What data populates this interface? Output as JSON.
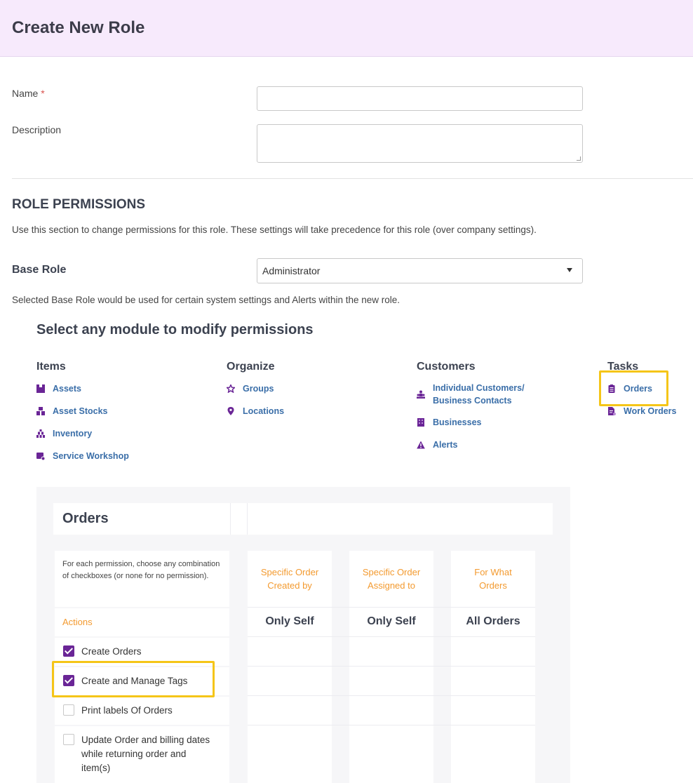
{
  "header": {
    "title": "Create New Role"
  },
  "form": {
    "name_label": "Name",
    "required_mark": "*",
    "name_value": "",
    "description_label": "Description",
    "description_value": ""
  },
  "permissions": {
    "title": "ROLE PERMISSIONS",
    "description": "Use this section to change permissions for this role. These settings will take precedence for this role (over company settings).",
    "base_role_label": "Base Role",
    "base_role_value": "Administrator",
    "base_role_note": "Selected Base Role would be used for certain system settings and Alerts within the new role."
  },
  "modules": {
    "title": "Select any module to modify permissions",
    "columns": [
      {
        "heading": "Items",
        "links": [
          "Assets",
          "Asset Stocks",
          "Inventory",
          "Service Workshop"
        ]
      },
      {
        "heading": "Organize",
        "links": [
          "Groups",
          "Locations"
        ]
      },
      {
        "heading": "Customers",
        "links": [
          "Individual Customers/",
          "Business Contacts",
          "Businesses",
          "Alerts"
        ]
      },
      {
        "heading": "Tasks",
        "links": [
          "Orders",
          "Work Orders"
        ]
      }
    ],
    "icon_color": "#6a2596",
    "link_color": "#3a6ea8",
    "highlight_color": "#f5c518"
  },
  "orders_table": {
    "title": "Orders",
    "instructions": "For each permission, choose any combination of checkboxes (or none for no permission).",
    "actions_label": "Actions",
    "columns": [
      {
        "header_line1": "Specific Order",
        "header_line2": "Created by",
        "value": "Only Self"
      },
      {
        "header_line1": "Specific Order",
        "header_line2": "Assigned to",
        "value": "Only Self"
      },
      {
        "header_line1": "For What",
        "header_line2": "Orders",
        "value": "All Orders"
      }
    ],
    "rows": [
      {
        "label": "Create Orders",
        "checked": true
      },
      {
        "label": "Create and Manage Tags",
        "checked": true
      },
      {
        "label": "Print labels Of Orders",
        "checked": false
      },
      {
        "label_line1": "Update Order and billing dates",
        "label_line2": "while returning order and",
        "label_line3": "item(s)",
        "checked": false
      }
    ]
  }
}
